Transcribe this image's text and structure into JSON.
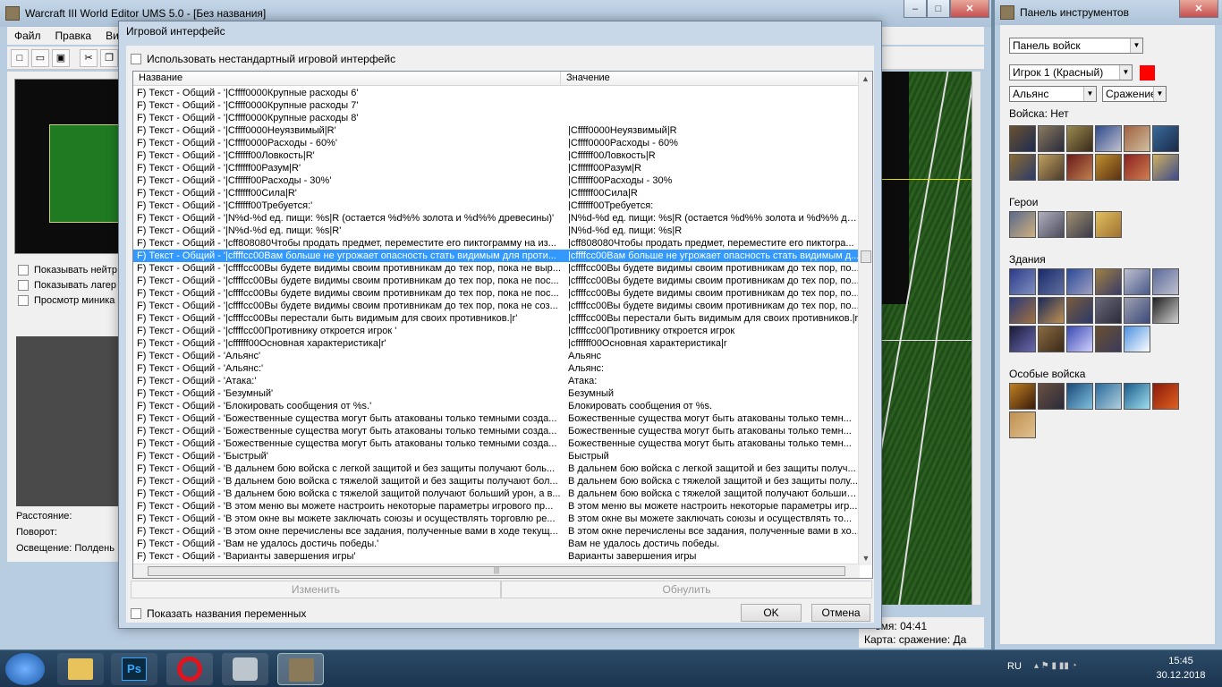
{
  "main": {
    "title": "Warcraft III World Editor UMS 5.0 - [Без названия]",
    "menu": [
      "Файл",
      "Правка",
      "Вид"
    ],
    "left_checks": [
      "Показывать нейтр",
      "Показывать лагер",
      "Просмотр миника"
    ],
    "info": [
      "Расстояние:",
      "Поворот:",
      "Освещение: Полдень"
    ],
    "status": {
      "time": "емя: 04:41",
      "map": "Карта: сражение: Да"
    }
  },
  "dialog": {
    "title": "Игровой интерфейс",
    "use_custom": "Использовать нестандартный игровой интерфейс",
    "col_name": "Название",
    "col_value": "Значение",
    "rows": [
      [
        "F) Текст - Общий - '|Cffff0000Крупные расходы 6'",
        ""
      ],
      [
        "F) Текст - Общий - '|Cffff0000Крупные расходы 7'",
        ""
      ],
      [
        "F) Текст - Общий - '|Cffff0000Крупные расходы 8'",
        ""
      ],
      [
        "F) Текст - Общий - '|Cffff0000Неуязвимый|R'",
        "|Cffff0000Неуязвимый|R"
      ],
      [
        "F) Текст - Общий - '|Cffff0000Расходы - 60%'",
        "|Cffff0000Расходы - 60%"
      ],
      [
        "F) Текст - Общий - '|Cffffff00Ловкость|R'",
        "|Cffffff00Ловкость|R"
      ],
      [
        "F) Текст - Общий - '|Cffffff00Разум|R'",
        "|Cffffff00Разум|R"
      ],
      [
        "F) Текст - Общий - '|Cffffff00Расходы - 30%'",
        "|Cffffff00Расходы - 30%"
      ],
      [
        "F) Текст - Общий - '|Cffffff00Сила|R'",
        "|Cffffff00Сила|R"
      ],
      [
        "F) Текст - Общий - '|Cffffff00Требуется:'",
        "|Cffffff00Требуется:"
      ],
      [
        "F) Текст - Общий - '|N%d-%d ед. пищи: %s|R (остается %d%% золота и %d%% древесины)'",
        "|N%d-%d ед. пищи: %s|R (остается %d%% золота и %d%% древе..."
      ],
      [
        "F) Текст - Общий - '|N%d-%d ед. пищи: %s|R'",
        "|N%d-%d ед. пищи: %s|R"
      ],
      [
        "F) Текст - Общий - '|cff808080Чтобы продать предмет, переместите его пиктограмму на из...",
        "|cff808080Чтобы продать предмет, переместите его пиктогра..."
      ],
      [
        "F) Текст - Общий - '|cffffcc00Вам больше не угрожает опасность стать видимым для проти...",
        "|cffffcc00Вам больше не угрожает опасность стать видимым д..."
      ],
      [
        "F) Текст - Общий - '|cffffcc00Вы будете видимы своим противникам до тех пор, пока не выр...",
        "|cffffcc00Вы будете видимы своим противникам до тех пор, по..."
      ],
      [
        "F) Текст - Общий - '|cffffcc00Вы будете видимы своим противникам до тех пор, пока не пос...",
        "|cffffcc00Вы будете видимы своим противникам до тех пор, по..."
      ],
      [
        "F) Текст - Общий - '|cffffcc00Вы будете видимы своим противникам до тех пор, пока не пос...",
        "|cffffcc00Вы будете видимы своим противникам до тех пор, по..."
      ],
      [
        "F) Текст - Общий - '|cffffcc00Вы будете видимы своим противникам до тех пор, пока не соз...",
        "|cffffcc00Вы будете видимы своим противникам до тех пор, по..."
      ],
      [
        "F) Текст - Общий - '|cffffcc00Вы перестали быть видимым для своих противников.|r'",
        "|cffffcc00Вы перестали быть видимым для своих противников.|r"
      ],
      [
        "F) Текст - Общий - '|cffffcc00Противнику откроется игрок '",
        "|cffffcc00Противнику откроется игрок"
      ],
      [
        "F) Текст - Общий - '|cffffff00Основная характеристика|r'",
        "|cffffff00Основная характеристика|r"
      ],
      [
        "F) Текст - Общий - 'Альянс'",
        "Альянс"
      ],
      [
        "F) Текст - Общий - 'Альянс:'",
        "Альянс:"
      ],
      [
        "F) Текст - Общий - 'Атака:'",
        "Атака:"
      ],
      [
        "F) Текст - Общий - 'Безумный'",
        "Безумный"
      ],
      [
        "F) Текст - Общий - 'Блокировать сообщения от %s.'",
        "Блокировать сообщения от %s."
      ],
      [
        "F) Текст - Общий - 'Божественные существа могут быть атакованы только темными созда...",
        "Божественные существа могут быть атакованы только темн..."
      ],
      [
        "F) Текст - Общий - 'Божественные существа могут быть атакованы только темными созда...",
        "Божественные существа могут быть атакованы только темн..."
      ],
      [
        "F) Текст - Общий - 'Божественные существа могут быть атакованы только темными созда...",
        "Божественные существа могут быть атакованы только темн..."
      ],
      [
        "F) Текст - Общий - 'Быстрый'",
        "Быстрый"
      ],
      [
        "F) Текст - Общий - 'В дальнем бою войска с легкой защитой и без защиты получают боль...",
        "В дальнем бою войска с легкой защитой и без защиты получ..."
      ],
      [
        "F) Текст - Общий - 'В дальнем бою войска с тяжелой защитой и без защиты получают бол...",
        "В дальнем бою войска с тяжелой защитой и без защиты полу..."
      ],
      [
        "F) Текст - Общий - 'В дальнем бою войска с тяжелой защитой получают больший урон, а в...",
        "В дальнем бою войска с тяжелой защитой получают больший ..."
      ],
      [
        "F) Текст - Общий - 'В этом меню вы можете настроить некоторые параметры игрового пр...",
        "В этом меню вы можете настроить некоторые параметры игр..."
      ],
      [
        "F) Текст - Общий - 'В этом окне вы можете заключать союзы и осуществлять торговлю ре...",
        "В этом окне вы можете заключать союзы и осуществлять то..."
      ],
      [
        "F) Текст - Общий - 'В этом окне перечислены все задания, полученные вами в ходе текущ...",
        "В этом окне перечислены все задания, полученные вами в хо..."
      ],
      [
        "F) Текст - Общий - 'Вам не удалось достичь победы.'",
        "Вам не удалось достичь победы."
      ],
      [
        "F) Текст - Общий - 'Варианты завершения игры'",
        "Варианты завершения игры"
      ]
    ],
    "btn_change": "Изменить",
    "btn_reset": "Обнулить",
    "show_vars": "Показать названия переменных",
    "btn_ok": "OK",
    "btn_cancel": "Отмена"
  },
  "tools": {
    "title": "Панель инструментов",
    "palette": "Панель войск",
    "player": "Игрок 1 (Красный)",
    "player_color": "#ff0000",
    "race": "Альянс",
    "mode": "Сражение",
    "troops_label": "Войска: Нет",
    "heroes_label": "Герои",
    "buildings_label": "Здания",
    "special_label": "Особые войска"
  },
  "taskbar": {
    "lang": "RU",
    "time": "15:45",
    "date": "30.12.2018"
  }
}
